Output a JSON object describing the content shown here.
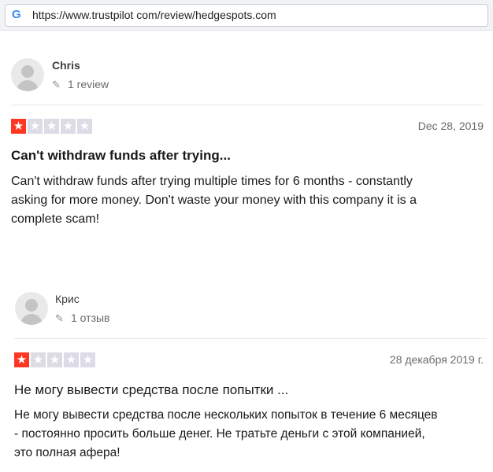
{
  "browser": {
    "url": "https://www.trustpilot com/review/hedgespots.com",
    "favicon": "google-g-icon"
  },
  "reviews": [
    {
      "author": "Chris",
      "review_count": "1 review",
      "rating": 1,
      "max_rating": 5,
      "date": "Dec 28, 2019",
      "title": "Can't withdraw funds after trying...",
      "body_lines": [
        "Can't withdraw funds after trying multiple times for 6 months - constantly",
        "asking for more money. Don't waste your money with this company it is a",
        "complete scam!"
      ]
    },
    {
      "author": "Крис",
      "review_count": "1 отзыв",
      "rating": 1,
      "max_rating": 5,
      "date": "28 декабря 2019 г.",
      "title": "Не могу вывести средства после попытки ...",
      "body_lines": [
        "Не могу вывести средства после нескольких попыток в течение 6 месяцев",
        "- постоянно просить больше денег. Не тратьте деньги с этой компанией,",
        "это полная афера!"
      ]
    }
  ],
  "colors": {
    "star_filled": "#ff3722",
    "star_empty": "#dcdce6"
  }
}
